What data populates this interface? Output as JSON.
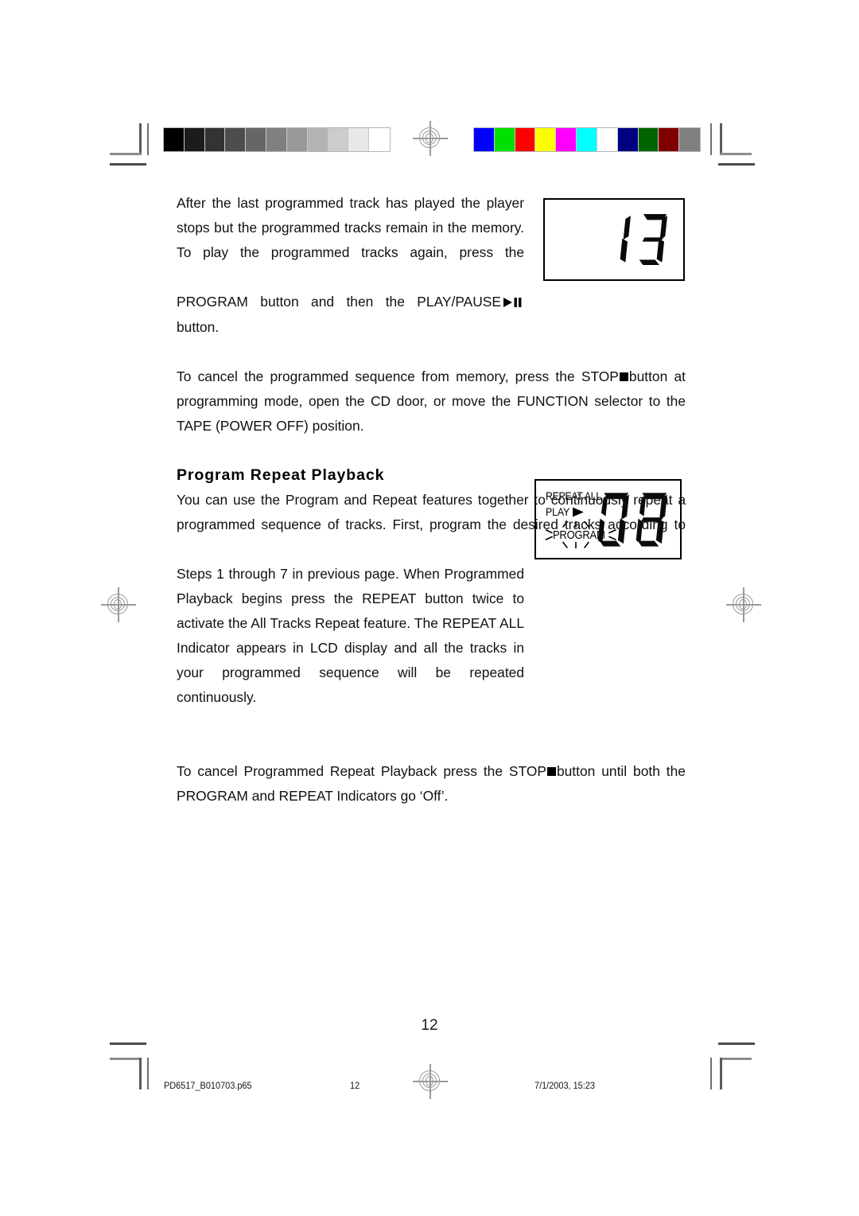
{
  "document": {
    "page_number": "12",
    "section_heading": "Program Repeat Playback",
    "paragraphs": {
      "p1": "After the last programmed track has played the player stops but the programmed tracks remain in the memory. To play the programmed tracks again, press the",
      "p1_end": "PROGRAM button and then the PLAY/PAUSE",
      "p1_end2": "button.",
      "p2_a": "To cancel the programmed sequence from memory, press the STOP",
      "p2_b": "button at programming mode, open the CD door, or move the FUNCTION selector to the TAPE (POWER OFF) position.",
      "p3": "You can use the Program and Repeat features together to continuously repeat a programmed sequence of tracks. First, program the desired tracks according to",
      "p4": "Steps 1 through 7 in previous page. When Programmed Playback begins press the REPEAT button twice to activate the All Tracks Repeat feature. The REPEAT ALL Indicator appears in LCD display and all the tracks in your programmed sequence will be repeated continuously.",
      "p5_a": "To cancel Programmed Repeat Playback press the STOP",
      "p5_b": "button until both the PROGRAM and REPEAT Indicators go ‘Off’."
    }
  },
  "lcd_display_1": {
    "digits": "13",
    "digit_values": [
      "1",
      "3"
    ]
  },
  "lcd_display_2": {
    "digits": "08",
    "digit_values": [
      "0",
      "8"
    ],
    "indicator_repeat": "REPEAT ALL",
    "indicator_play": "PLAY",
    "indicator_program": "PROGRAM"
  },
  "footer": {
    "file_name": "PD6517_B010703.p65",
    "page": "12",
    "timestamp": "7/1/2003, 15:23"
  },
  "calibration": {
    "grayscale": [
      "#000000",
      "#1c1c1c",
      "#333333",
      "#4d4d4d",
      "#666666",
      "#808080",
      "#999999",
      "#b3b3b3",
      "#cccccc",
      "#e8e8e8",
      "#ffffff"
    ],
    "colors": [
      "#0000ff",
      "#00e000",
      "#ff0000",
      "#ffff00",
      "#ff00ff",
      "#00ffff",
      "#ffffff",
      "#000080",
      "#006400",
      "#800000",
      "#808080"
    ]
  }
}
